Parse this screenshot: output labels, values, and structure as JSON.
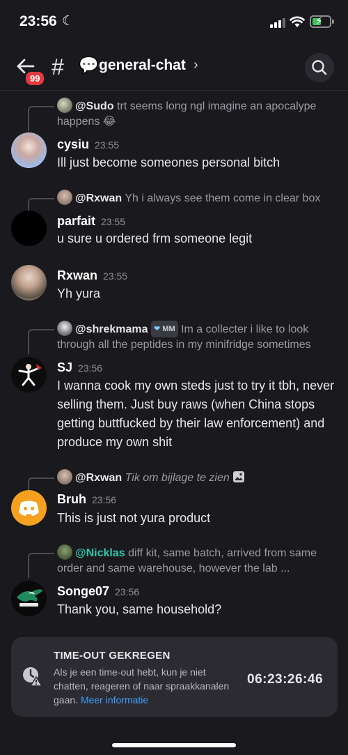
{
  "status": {
    "time": "23:56"
  },
  "header": {
    "badge": "99",
    "channel_emoji": "💬",
    "channel_name": "general-chat",
    "chevron": "›"
  },
  "messages": [
    {
      "reply": {
        "name": "@Sudo",
        "text": "trt seems long ngl imagine an apocalype happens 😂"
      },
      "author": "cysiu",
      "time": "23:55",
      "text": "Ill just become someones personal bitch"
    },
    {
      "reply": {
        "name": "@Rxwan",
        "text": "Yh i always see them come in clear box"
      },
      "author": "parfait",
      "time": "23:55",
      "text": "u sure u ordered frm someone legit"
    },
    {
      "author": "Rxwan",
      "time": "23:55",
      "text": "Yh yura"
    },
    {
      "reply": {
        "name": "@shrekmama",
        "badge": "MM",
        "text": "Im a collecter i like to look through all the peptides in my minifridge sometimes"
      },
      "author": "SJ",
      "time": "23:56",
      "text": "I wanna cook my own steds  just to try it tbh, never selling them. Just buy raws (when China stops getting buttfucked by their law enforcement) and produce my own shit"
    },
    {
      "reply": {
        "name": "@Rxwan",
        "text": "Tik om bijlage te zien"
      },
      "author": "Bruh",
      "time": "23:56",
      "text": "This is just not yura product"
    },
    {
      "reply": {
        "name": "@Nicklas",
        "text": "diff kit, same batch, arrived from same order and same warehouse, however the lab ..."
      },
      "author": "Songe07",
      "time": "23:56",
      "text": "Thank you, same household?"
    }
  ],
  "timeout": {
    "title": "TIME-OUT GEKREGEN",
    "desc": "Als je een time-out hebt, kun je niet chatten, reageren of naar spraakkanalen gaan.",
    "link": "Meer informatie",
    "countdown": "06:23:26:46"
  },
  "colors": {
    "background": "#1a1a1e",
    "link": "#3fa0ff",
    "badge": "#e5383f",
    "mention_green": "#2dc7a8"
  }
}
